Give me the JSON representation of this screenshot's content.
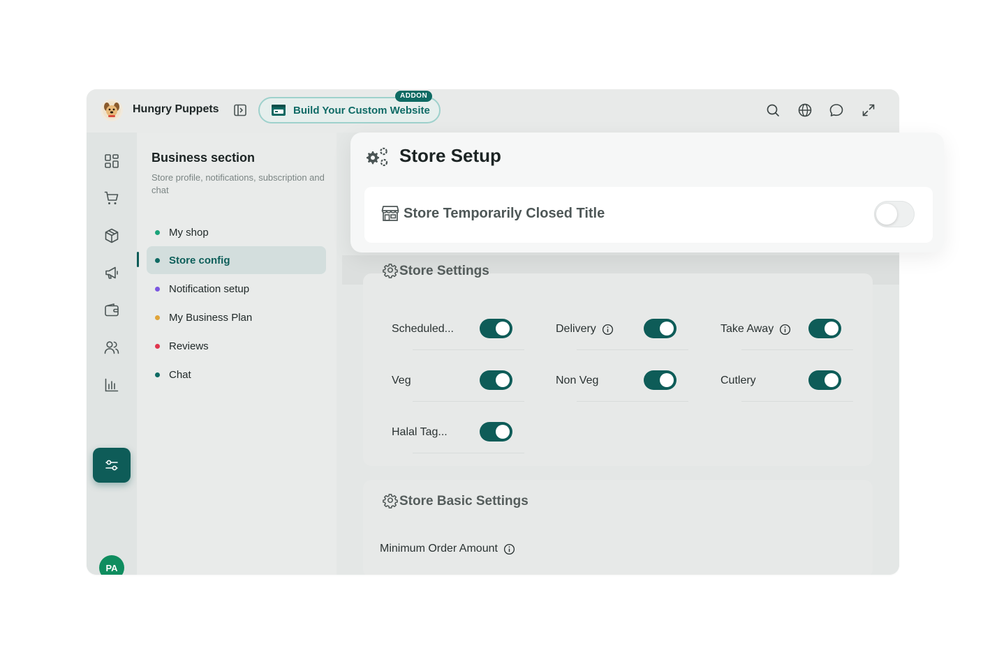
{
  "header": {
    "brand": "Hungry Puppets",
    "addon_button_label": "Build Your Custom Website",
    "addon_badge": "ADDON"
  },
  "rail": {
    "icons": [
      "dashboard-icon",
      "cart-icon",
      "box-icon",
      "megaphone-icon",
      "wallet-icon",
      "users-icon",
      "chart-icon",
      "sliders-icon"
    ],
    "avatar_initials": "PA"
  },
  "sidebar": {
    "title": "Business section",
    "subtitle": "Store profile, notifications, subscription and chat",
    "items": [
      {
        "label": "My shop",
        "dot": "#1aa37a"
      },
      {
        "label": "Store config",
        "dot": "#0e6a63"
      },
      {
        "label": "Notification setup",
        "dot": "#7b57e0"
      },
      {
        "label": "My Business Plan",
        "dot": "#e0a43a"
      },
      {
        "label": "Reviews",
        "dot": "#e0364e"
      },
      {
        "label": "Chat",
        "dot": "#0e6a63"
      }
    ]
  },
  "store_setup": {
    "title": "Store Setup",
    "closed_title": "Store Temporarily Closed Title",
    "closed_toggle_on": false
  },
  "store_settings": {
    "title": "Store Settings",
    "options": [
      {
        "label": "Scheduled...",
        "info": false,
        "on": true
      },
      {
        "label": "Delivery",
        "info": true,
        "on": true
      },
      {
        "label": "Take Away",
        "info": true,
        "on": true
      },
      {
        "label": "Veg",
        "info": false,
        "on": true
      },
      {
        "label": "Non Veg",
        "info": false,
        "on": true
      },
      {
        "label": "Cutlery",
        "info": false,
        "on": true
      },
      {
        "label": "Halal Tag...",
        "info": false,
        "on": true
      }
    ]
  },
  "basic_settings": {
    "title": "Store Basic Settings",
    "min_order_label": "Minimum Order Amount"
  },
  "colors": {
    "primary": "#0e5c58",
    "accent_border": "#9ed1cc",
    "avatar": "#0f8d5f"
  }
}
